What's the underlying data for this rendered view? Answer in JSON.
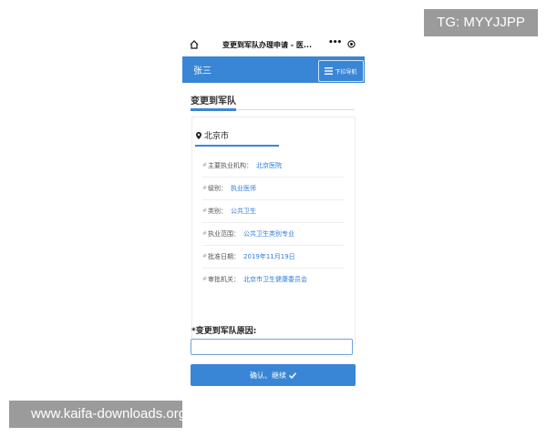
{
  "watermarks": {
    "top": "TG: MYYJJPP",
    "bottom": "www.kaifa-downloads.org"
  },
  "wechat_bar": {
    "title": "变更到军队办理申请 - 医...",
    "more": "•••"
  },
  "header": {
    "user_name": "张三",
    "nav_label": "下拉导航"
  },
  "page": {
    "title": "变更到军队"
  },
  "card": {
    "city": "北京市",
    "rows": [
      {
        "label": "主要执业机构：",
        "value": "北京医院"
      },
      {
        "label": "级别：",
        "value": "执业医师"
      },
      {
        "label": "类别：",
        "value": "公共卫生"
      },
      {
        "label": "执业范围：",
        "value": "公共卫生类别专业"
      },
      {
        "label": "批准日期：",
        "value": "2019年11月19日"
      },
      {
        "label": "审批机关：",
        "value": "北京市卫生健康委员会"
      }
    ]
  },
  "form": {
    "reason_label": "*变更到军队原因:",
    "reason_value": "",
    "confirm_label": "确认、继续"
  },
  "colors": {
    "accent": "#3a86d6",
    "link": "#2f7ed8"
  }
}
